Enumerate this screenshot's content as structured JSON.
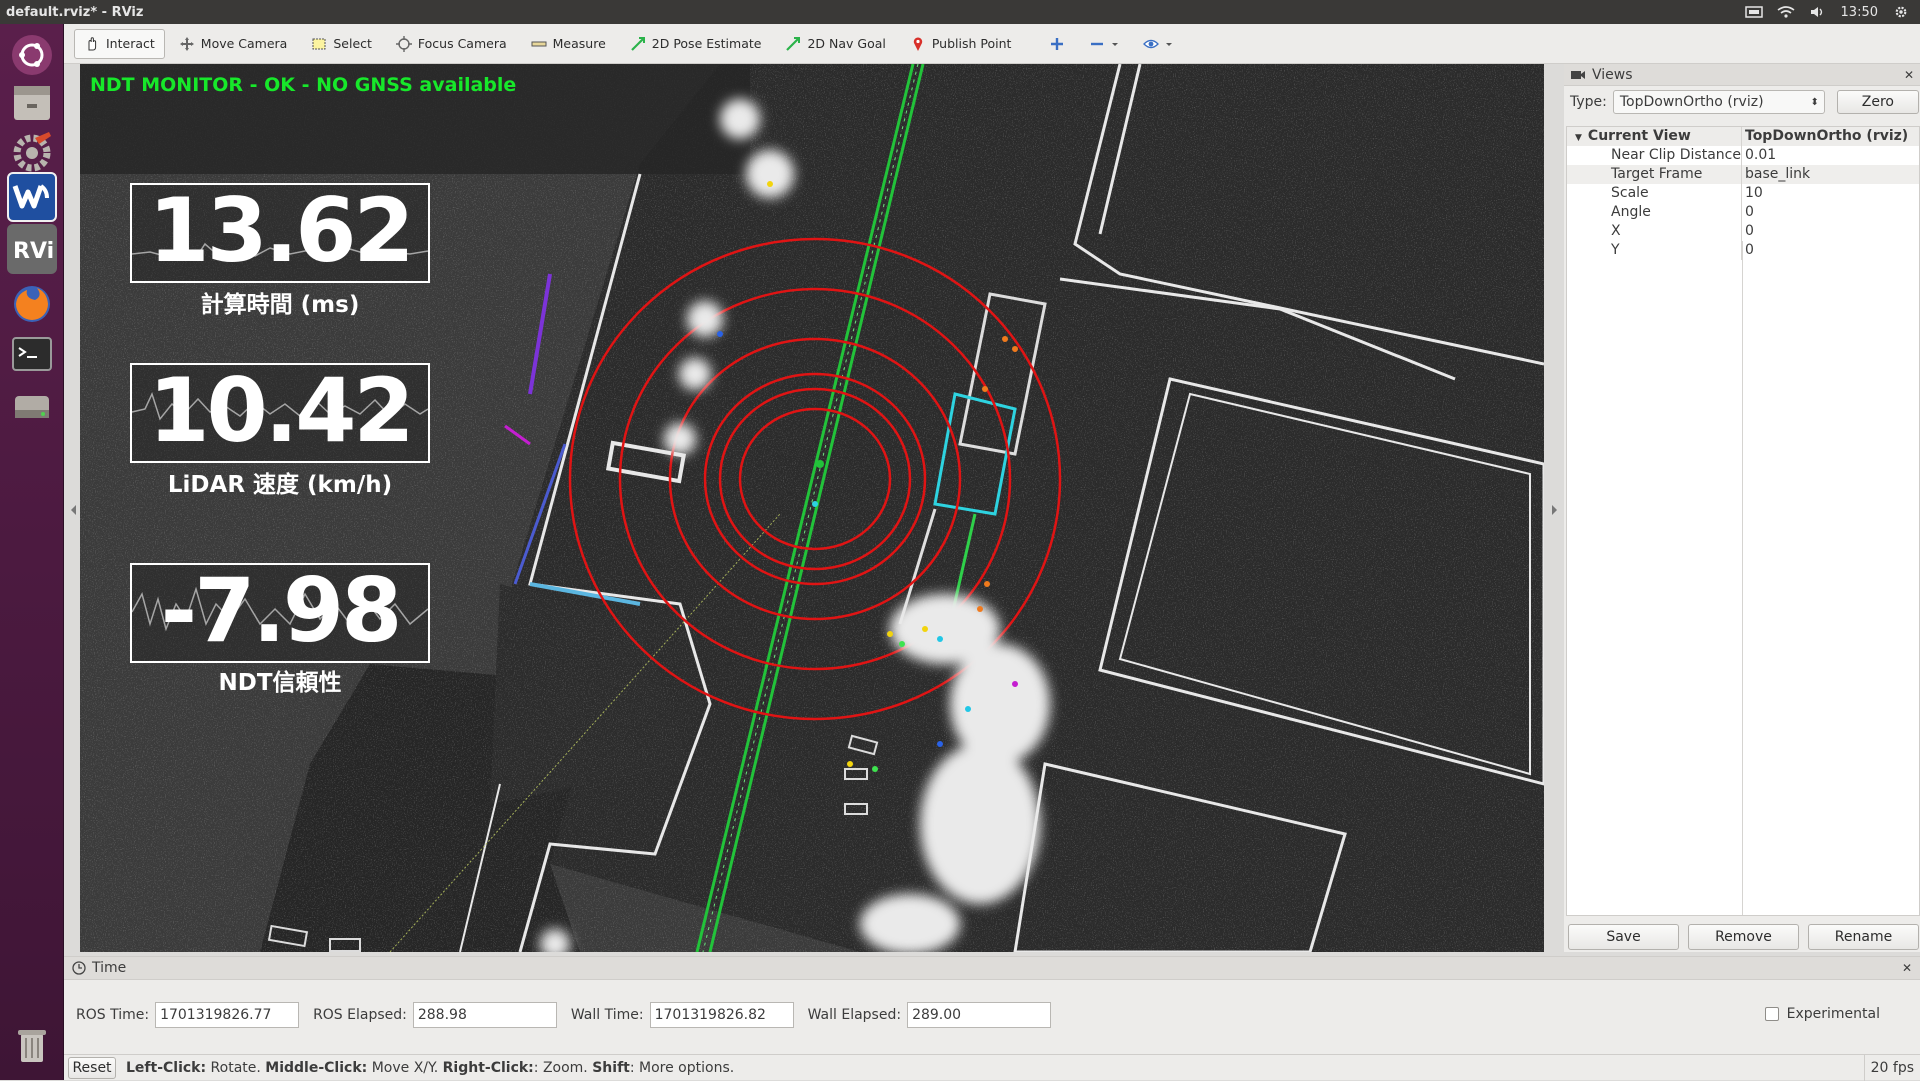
{
  "window": {
    "title": "default.rviz* - RViz"
  },
  "tray": {
    "clock": "13:50"
  },
  "launcher": {
    "items": [
      {
        "name": "ubuntu-dash-icon"
      },
      {
        "name": "files-icon"
      },
      {
        "name": "settings-icon"
      },
      {
        "name": "autoware-icon",
        "label": "autoware"
      },
      {
        "name": "rviz-icon",
        "label": "RViz"
      },
      {
        "name": "firefox-icon"
      },
      {
        "name": "terminal-icon"
      },
      {
        "name": "disk-icon"
      },
      {
        "name": "trash-icon"
      }
    ]
  },
  "toolbar": {
    "interact": "Interact",
    "move_camera": "Move Camera",
    "select": "Select",
    "focus_camera": "Focus Camera",
    "measure": "Measure",
    "pose_estimate": "2D Pose Estimate",
    "nav_goal": "2D Nav Goal",
    "publish_point": "Publish Point"
  },
  "overlay": {
    "status": "NDT MONITOR - OK - NO GNSS available",
    "gauges": [
      {
        "value": "13.62",
        "label": "計算時間 (ms)"
      },
      {
        "value": "10.42",
        "label": "LiDAR 速度 (km/h)"
      },
      {
        "value": "-7.98",
        "label": "NDT信頼性"
      }
    ]
  },
  "views": {
    "title": "Views",
    "type_label": "Type:",
    "type_value": "TopDownOrtho (rviz)",
    "zero_button": "Zero",
    "tree": {
      "head_key": "Current View",
      "head_value": "TopDownOrtho (rviz)",
      "rows": [
        {
          "key": "Near Clip Distance",
          "value": "0.01"
        },
        {
          "key": "Target Frame",
          "value": "base_link"
        },
        {
          "key": "Scale",
          "value": "10"
        },
        {
          "key": "Angle",
          "value": "0"
        },
        {
          "key": "X",
          "value": "0"
        },
        {
          "key": "Y",
          "value": "0"
        }
      ]
    },
    "save": "Save",
    "remove": "Remove",
    "rename": "Rename"
  },
  "time": {
    "title": "Time",
    "ros_time_label": "ROS Time:",
    "ros_time": "1701319826.77",
    "ros_elapsed_label": "ROS Elapsed:",
    "ros_elapsed": "288.98",
    "wall_time_label": "Wall Time:",
    "wall_time": "1701319826.82",
    "wall_elapsed_label": "Wall Elapsed:",
    "wall_elapsed": "289.00",
    "experimental": "Experimental"
  },
  "status": {
    "reset": "Reset",
    "h1": "Left-Click:",
    "t1": " Rotate. ",
    "h2": "Middle-Click:",
    "t2": " Move X/Y. ",
    "h3": "Right-Click:",
    "t3": ": Zoom. ",
    "h4": "Shift",
    "t4": ": More options.",
    "fps": "20 fps"
  },
  "colors": {
    "ndt_ok": "#17e82a",
    "rings": "#e01414",
    "lane": "#22c33a"
  }
}
